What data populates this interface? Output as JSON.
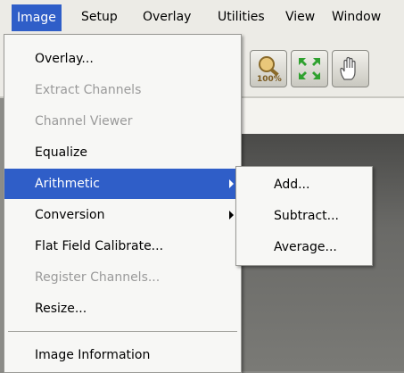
{
  "menubar": {
    "items": [
      {
        "label": "Image",
        "active": true
      },
      {
        "label": "Setup"
      },
      {
        "label": "Overlay"
      },
      {
        "label": "Utilities"
      },
      {
        "label": "View"
      },
      {
        "label": "Window"
      }
    ]
  },
  "toolbar": {
    "buttons": [
      {
        "icon": "zoom-100-icon",
        "label": "100%"
      },
      {
        "icon": "fit-window-icon"
      },
      {
        "icon": "pan-hand-icon"
      }
    ]
  },
  "image_menu": {
    "items": [
      {
        "label": "Overlay...",
        "enabled": true
      },
      {
        "label": "Extract Channels",
        "enabled": false
      },
      {
        "label": "Channel Viewer",
        "enabled": false
      },
      {
        "label": "Equalize",
        "enabled": true
      },
      {
        "label": "Arithmetic",
        "enabled": true,
        "highlighted": true,
        "submenu": true
      },
      {
        "label": "Conversion",
        "enabled": true,
        "submenu": true
      },
      {
        "label": "Flat Field Calibrate...",
        "enabled": true
      },
      {
        "label": "Register Channels...",
        "enabled": false
      },
      {
        "label": "Resize...",
        "enabled": true
      },
      {
        "label": "Image Information",
        "enabled": true
      }
    ]
  },
  "arithmetic_submenu": {
    "items": [
      {
        "label": "Add..."
      },
      {
        "label": "Subtract..."
      },
      {
        "label": "Average..."
      }
    ]
  },
  "colors": {
    "highlight": "#2f5ec8",
    "menu_bg": "#f7f7f5",
    "menubar_bg": "#ecebe6",
    "disabled_text": "#9a9a9a"
  }
}
